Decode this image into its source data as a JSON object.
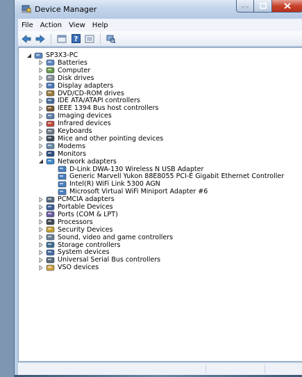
{
  "window": {
    "title": "Device Manager",
    "controls": {
      "minimize": "minimize",
      "maximize": "maximize",
      "close": "close"
    }
  },
  "menu": [
    "File",
    "Action",
    "View",
    "Help"
  ],
  "toolbar": [
    "back-arrow-icon",
    "forward-arrow-icon",
    "properties-icon",
    "help-icon",
    "list-view-icon",
    "scan-hardware-icon"
  ],
  "tree": {
    "root": "SP3X3-PC",
    "categories": [
      {
        "label": "Batteries",
        "icon": "battery-icon",
        "expanded": false
      },
      {
        "label": "Computer",
        "icon": "computer-icon",
        "expanded": false
      },
      {
        "label": "Disk drives",
        "icon": "disk-drive-icon",
        "expanded": false
      },
      {
        "label": "Display adapters",
        "icon": "display-adapter-icon",
        "expanded": false
      },
      {
        "label": "DVD/CD-ROM drives",
        "icon": "dvd-drive-icon",
        "expanded": false
      },
      {
        "label": "IDE ATA/ATAPI controllers",
        "icon": "ide-controller-icon",
        "expanded": false
      },
      {
        "label": "IEEE 1394 Bus host controllers",
        "icon": "ieee1394-icon",
        "expanded": false
      },
      {
        "label": "Imaging devices",
        "icon": "camera-icon",
        "expanded": false
      },
      {
        "label": "Infrared devices",
        "icon": "infrared-icon",
        "expanded": false
      },
      {
        "label": "Keyboards",
        "icon": "keyboard-icon",
        "expanded": false
      },
      {
        "label": "Mice and other pointing devices",
        "icon": "mouse-icon",
        "expanded": false
      },
      {
        "label": "Modems",
        "icon": "modem-icon",
        "expanded": false
      },
      {
        "label": "Monitors",
        "icon": "monitor-icon",
        "expanded": false
      },
      {
        "label": "Network adapters",
        "icon": "network-adapter-icon",
        "expanded": true,
        "children": [
          "D-Link DWA-130 Wireless N USB Adapter",
          "Generic Marvell Yukon 88E8055 PCI-E Gigabit Ethernet Controller",
          "Intel(R) WiFi Link 5300 AGN",
          "Microsoft Virtual WiFi Miniport Adapter #6"
        ]
      },
      {
        "label": "PCMCIA adapters",
        "icon": "pcmcia-icon",
        "expanded": false
      },
      {
        "label": "Portable Devices",
        "icon": "portable-device-icon",
        "expanded": false
      },
      {
        "label": "Ports (COM & LPT)",
        "icon": "port-icon",
        "expanded": false
      },
      {
        "label": "Processors",
        "icon": "processor-icon",
        "expanded": false
      },
      {
        "label": "Security Devices",
        "icon": "security-device-icon",
        "expanded": false
      },
      {
        "label": "Sound, video and game controllers",
        "icon": "sound-icon",
        "expanded": false
      },
      {
        "label": "Storage controllers",
        "icon": "storage-controller-icon",
        "expanded": false
      },
      {
        "label": "System devices",
        "icon": "system-device-icon",
        "expanded": false
      },
      {
        "label": "Universal Serial Bus controllers",
        "icon": "usb-icon",
        "expanded": false
      },
      {
        "label": "VSO devices",
        "icon": "vso-device-icon",
        "expanded": false
      }
    ]
  },
  "colors": {
    "window_frame": "#b9cde5",
    "close_button": "#c8432b",
    "text": "#000000"
  }
}
